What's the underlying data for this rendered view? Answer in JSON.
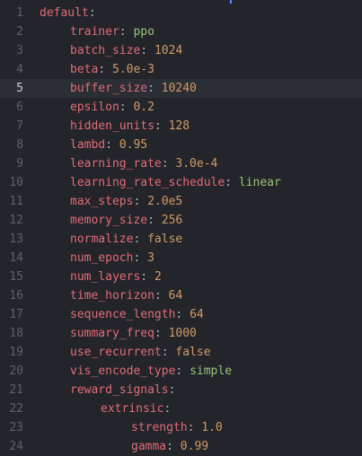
{
  "editor": {
    "active_line": 5,
    "lines": [
      {
        "num": "1",
        "indent": 0,
        "key": "default",
        "value": "",
        "vtype": ""
      },
      {
        "num": "2",
        "indent": 1,
        "key": "trainer",
        "value": "ppo",
        "vtype": "str"
      },
      {
        "num": "3",
        "indent": 1,
        "key": "batch_size",
        "value": "1024",
        "vtype": "num"
      },
      {
        "num": "4",
        "indent": 1,
        "key": "beta",
        "value": "5.0e-3",
        "vtype": "num"
      },
      {
        "num": "5",
        "indent": 1,
        "key": "buffer_size",
        "value": "10240",
        "vtype": "num"
      },
      {
        "num": "6",
        "indent": 1,
        "key": "epsilon",
        "value": "0.2",
        "vtype": "num"
      },
      {
        "num": "7",
        "indent": 1,
        "key": "hidden_units",
        "value": "128",
        "vtype": "num"
      },
      {
        "num": "8",
        "indent": 1,
        "key": "lambd",
        "value": "0.95",
        "vtype": "num"
      },
      {
        "num": "9",
        "indent": 1,
        "key": "learning_rate",
        "value": "3.0e-4",
        "vtype": "num"
      },
      {
        "num": "10",
        "indent": 1,
        "key": "learning_rate_schedule",
        "value": "linear",
        "vtype": "str"
      },
      {
        "num": "11",
        "indent": 1,
        "key": "max_steps",
        "value": "2.0e5",
        "vtype": "num"
      },
      {
        "num": "12",
        "indent": 1,
        "key": "memory_size",
        "value": "256",
        "vtype": "num"
      },
      {
        "num": "13",
        "indent": 1,
        "key": "normalize",
        "value": "false",
        "vtype": "bool"
      },
      {
        "num": "14",
        "indent": 1,
        "key": "num_epoch",
        "value": "3",
        "vtype": "num"
      },
      {
        "num": "15",
        "indent": 1,
        "key": "num_layers",
        "value": "2",
        "vtype": "num"
      },
      {
        "num": "16",
        "indent": 1,
        "key": "time_horizon",
        "value": "64",
        "vtype": "num"
      },
      {
        "num": "17",
        "indent": 1,
        "key": "sequence_length",
        "value": "64",
        "vtype": "num"
      },
      {
        "num": "18",
        "indent": 1,
        "key": "summary_freq",
        "value": "1000",
        "vtype": "num"
      },
      {
        "num": "19",
        "indent": 1,
        "key": "use_recurrent",
        "value": "false",
        "vtype": "bool"
      },
      {
        "num": "20",
        "indent": 1,
        "key": "vis_encode_type",
        "value": "simple",
        "vtype": "str"
      },
      {
        "num": "21",
        "indent": 1,
        "key": "reward_signals",
        "value": "",
        "vtype": ""
      },
      {
        "num": "22",
        "indent": 2,
        "key": "extrinsic",
        "value": "",
        "vtype": ""
      },
      {
        "num": "23",
        "indent": 3,
        "key": "strength",
        "value": "1.0",
        "vtype": "num"
      },
      {
        "num": "24",
        "indent": 3,
        "key": "gamma",
        "value": "0.99",
        "vtype": "num"
      }
    ]
  },
  "colors": {
    "background": "#23252b",
    "active_line": "#2b2e35",
    "key": "#e06c75",
    "number": "#d19a66",
    "string": "#98c379",
    "gutter": "#5b606b"
  }
}
